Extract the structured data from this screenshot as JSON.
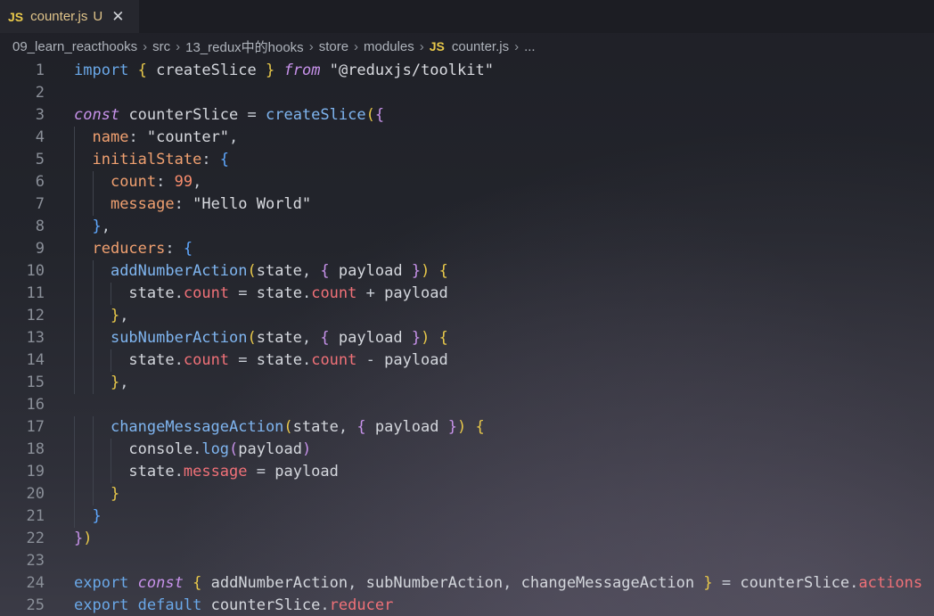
{
  "tab": {
    "badge": "JS",
    "filename": "counter.js",
    "status": "U",
    "close": "✕"
  },
  "breadcrumb": {
    "parts": [
      "09_learn_reacthooks",
      "src",
      "13_redux中的hooks",
      "store",
      "modules"
    ],
    "file_badge": "JS",
    "file": "counter.js",
    "tail": "...",
    "separator": "›"
  },
  "code": {
    "language": "javascript",
    "lines": [
      {
        "n": "1",
        "text": "import { createSlice } from \"@reduxjs/toolkit\""
      },
      {
        "n": "2",
        "text": ""
      },
      {
        "n": "3",
        "text": "const counterSlice = createSlice({"
      },
      {
        "n": "4",
        "text": "  name: \"counter\","
      },
      {
        "n": "5",
        "text": "  initialState: {"
      },
      {
        "n": "6",
        "text": "    count: 99,"
      },
      {
        "n": "7",
        "text": "    message: \"Hello World\""
      },
      {
        "n": "8",
        "text": "  },"
      },
      {
        "n": "9",
        "text": "  reducers: {"
      },
      {
        "n": "10",
        "text": "    addNumberAction(state, { payload }) {"
      },
      {
        "n": "11",
        "text": "      state.count = state.count + payload"
      },
      {
        "n": "12",
        "text": "    },"
      },
      {
        "n": "13",
        "text": "    subNumberAction(state, { payload }) {"
      },
      {
        "n": "14",
        "text": "      state.count = state.count - payload"
      },
      {
        "n": "15",
        "text": "    },"
      },
      {
        "n": "16",
        "text": ""
      },
      {
        "n": "17",
        "text": "    changeMessageAction(state, { payload }) {"
      },
      {
        "n": "18",
        "text": "      console.log(payload)"
      },
      {
        "n": "19",
        "text": "      state.message = payload"
      },
      {
        "n": "20",
        "text": "    }"
      },
      {
        "n": "21",
        "text": "  }"
      },
      {
        "n": "22",
        "text": "})"
      },
      {
        "n": "23",
        "text": ""
      },
      {
        "n": "24",
        "text": "export const { addNumberAction, subNumberAction, changeMessageAction } = counterSlice.actions"
      },
      {
        "n": "25",
        "text": "export default counterSlice.reducer"
      }
    ]
  },
  "colors": {
    "keyword": "#6aa8e8",
    "string": "#d9dbe0",
    "property": "#f07178",
    "number": "#f78c6c",
    "bracket_level1": "#e9c94a",
    "bracket_level2": "#c792ea",
    "bracket_level3": "#5fa8ff",
    "js_badge": "#e9c94a",
    "modified_file": "#e0c48a"
  }
}
